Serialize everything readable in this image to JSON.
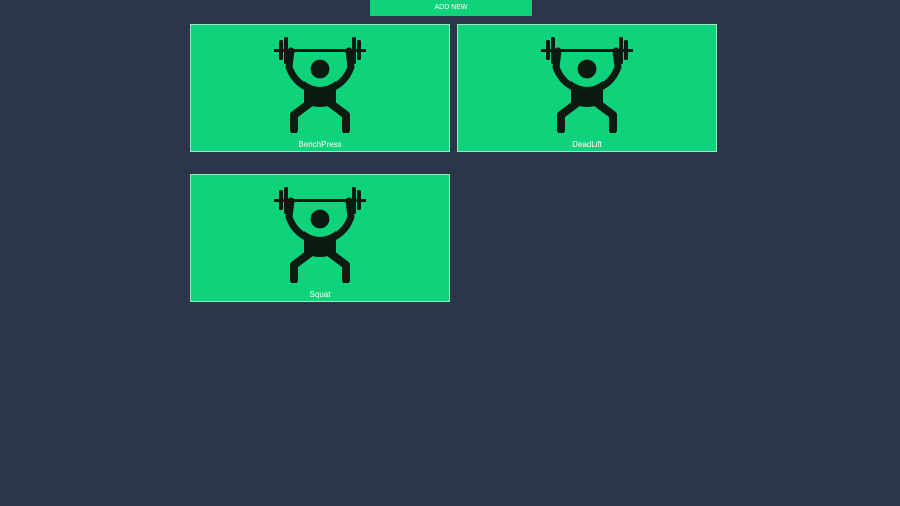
{
  "toolbar": {
    "add_label": "ADD NEW"
  },
  "exercises": [
    {
      "name": "BenchPress",
      "icon": "weightlifter-icon"
    },
    {
      "name": "DeadLift",
      "icon": "weightlifter-icon"
    },
    {
      "name": "Squat",
      "icon": "weightlifter-icon"
    }
  ],
  "colors": {
    "background": "#2c3649",
    "accent": "#0fd37a",
    "card_border": "#9ae8c2",
    "icon": "#0c1a12",
    "text": "#ffffff"
  }
}
